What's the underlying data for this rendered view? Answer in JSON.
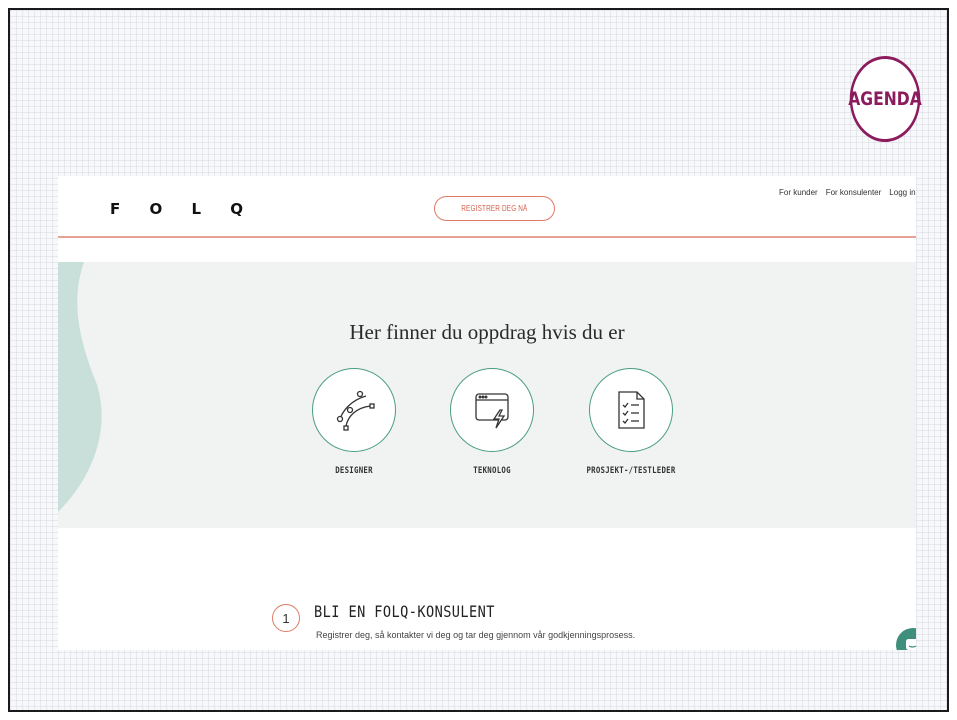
{
  "badge": {
    "label": "AGENDA",
    "color": "#8c1b5e"
  },
  "nav": {
    "logo": "F O L Q",
    "register_label": "REGISTRER DEG NÅ",
    "links": [
      "For kunder",
      "For konsulenter",
      "Logg inn"
    ]
  },
  "hero": {
    "title": "Her finner du oppdrag hvis du er",
    "roles": [
      {
        "label": "DESIGNER",
        "icon": "bezier-pen-icon"
      },
      {
        "label": "TEKNOLOG",
        "icon": "browser-lightning-icon"
      },
      {
        "label": "PROSJEKT-/TESTLEDER",
        "icon": "checklist-document-icon"
      }
    ]
  },
  "step": {
    "number": "1",
    "title": "BLI EN FOLQ-KONSULENT",
    "text": "Registrer deg, så kontakter vi deg og tar deg gjennom vår godkjenningsprosess."
  },
  "colors": {
    "accent_coral": "#e07a66",
    "accent_green": "#4a9e85",
    "wave_teal": "#c9e0da"
  }
}
